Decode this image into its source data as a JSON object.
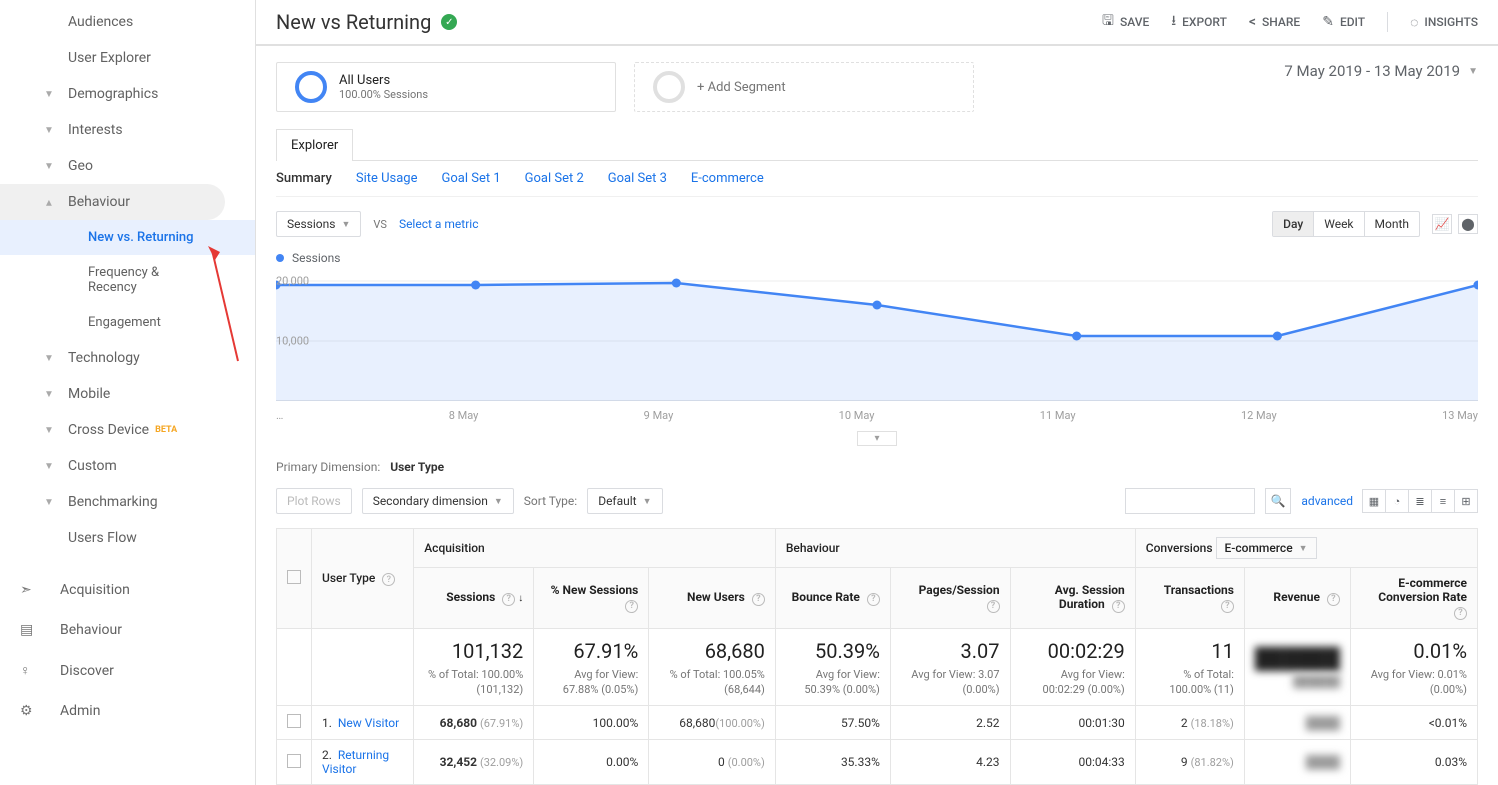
{
  "header": {
    "title": "New vs Returning",
    "actions": {
      "save": "SAVE",
      "export": "EXPORT",
      "share": "SHARE",
      "edit": "EDIT",
      "insights": "INSIGHTS"
    },
    "date_range": "7 May 2019 - 13 May 2019"
  },
  "sidebar": {
    "items": [
      {
        "label": "Audiences",
        "type": "link"
      },
      {
        "label": "User Explorer",
        "type": "link"
      },
      {
        "label": "Demographics",
        "type": "collapsible"
      },
      {
        "label": "Interests",
        "type": "collapsible"
      },
      {
        "label": "Geo",
        "type": "collapsible"
      },
      {
        "label": "Behaviour",
        "type": "collapsible",
        "expanded": true
      },
      {
        "label": "New vs. Returning",
        "type": "sub",
        "active": true
      },
      {
        "label": "Frequency & Recency",
        "type": "sub"
      },
      {
        "label": "Engagement",
        "type": "sub"
      },
      {
        "label": "Technology",
        "type": "collapsible"
      },
      {
        "label": "Mobile",
        "type": "collapsible"
      },
      {
        "label": "Cross Device",
        "type": "collapsible",
        "beta": "BETA"
      },
      {
        "label": "Custom",
        "type": "collapsible"
      },
      {
        "label": "Benchmarking",
        "type": "collapsible"
      },
      {
        "label": "Users Flow",
        "type": "link"
      }
    ],
    "main_nav": [
      {
        "label": "Acquisition"
      },
      {
        "label": "Behaviour"
      },
      {
        "label": "Discover"
      },
      {
        "label": "Admin"
      }
    ]
  },
  "segments": {
    "all_users": {
      "title": "All Users",
      "subtitle": "100.00% Sessions"
    },
    "add": "+ Add Segment"
  },
  "tabs": {
    "explorer": "Explorer"
  },
  "subtabs": [
    "Summary",
    "Site Usage",
    "Goal Set 1",
    "Goal Set 2",
    "Goal Set 3",
    "E-commerce"
  ],
  "chart_controls": {
    "metric": "Sessions",
    "vs": "VS",
    "select_metric": "Select a metric",
    "periods": [
      "Day",
      "Week",
      "Month"
    ]
  },
  "legend": {
    "series": "Sessions"
  },
  "chart_data": {
    "type": "line",
    "ylabel": "",
    "ylim": [
      0,
      20000
    ],
    "yticks": [
      "20,000",
      "10,000"
    ],
    "categories": [
      "…",
      "8 May",
      "9 May",
      "10 May",
      "11 May",
      "12 May",
      "13 May"
    ],
    "series": [
      {
        "name": "Sessions",
        "values": [
          19200,
          19200,
          19500,
          16000,
          10800,
          10800,
          19200
        ]
      }
    ]
  },
  "dimension": {
    "label": "Primary Dimension:",
    "value": "User Type"
  },
  "toolbar": {
    "plot_rows": "Plot Rows",
    "secondary": "Secondary dimension",
    "sort_type_label": "Sort Type:",
    "sort_type": "Default",
    "advanced": "advanced"
  },
  "table": {
    "user_type_header": "User Type",
    "group_headers": {
      "acq": "Acquisition",
      "beh": "Behaviour",
      "conv": "Conversions",
      "conv_select": "E-commerce"
    },
    "metric_headers": [
      "Sessions",
      "% New Sessions",
      "New Users",
      "Bounce Rate",
      "Pages/Session",
      "Avg. Session Duration",
      "Transactions",
      "Revenue",
      "E-commerce Conversion Rate"
    ],
    "totals": {
      "sessions": {
        "big": "101,132",
        "sub": "% of Total: 100.00% (101,132)"
      },
      "pct_new": {
        "big": "67.91%",
        "sub": "Avg for View: 67.88% (0.05%)"
      },
      "new_users": {
        "big": "68,680",
        "sub": "% of Total: 100.05% (68,644)"
      },
      "bounce": {
        "big": "50.39%",
        "sub": "Avg for View: 50.39% (0.00%)"
      },
      "pages": {
        "big": "3.07",
        "sub": "Avg for View: 3.07 (0.00%)"
      },
      "duration": {
        "big": "00:02:29",
        "sub": "Avg for View: 00:02:29 (0.00%)"
      },
      "transactions": {
        "big": "11",
        "sub": "% of Total: 100.00% (11)"
      },
      "revenue": {
        "big": "██████",
        "sub": "██████"
      },
      "ecr": {
        "big": "0.01%",
        "sub": "Avg for View: 0.01% (0.00%)"
      }
    },
    "rows": [
      {
        "idx": "1.",
        "label": "New Visitor",
        "sessions": "68,680",
        "sessions_pct": "(67.91%)",
        "pct_new": "100.00%",
        "new_users": "68,680",
        "new_users_pct": "(100.00%)",
        "bounce": "57.50%",
        "pages": "2.52",
        "duration": "00:01:30",
        "trans": "2",
        "trans_pct": "(18.18%)",
        "revenue": "████",
        "ecr": "<0.01%"
      },
      {
        "idx": "2.",
        "label": "Returning Visitor",
        "sessions": "32,452",
        "sessions_pct": "(32.09%)",
        "pct_new": "0.00%",
        "new_users": "0",
        "new_users_pct": "(0.00%)",
        "bounce": "35.33%",
        "pages": "4.23",
        "duration": "00:04:33",
        "trans": "9",
        "trans_pct": "(81.82%)",
        "revenue": "████",
        "ecr": "0.03%"
      }
    ]
  }
}
